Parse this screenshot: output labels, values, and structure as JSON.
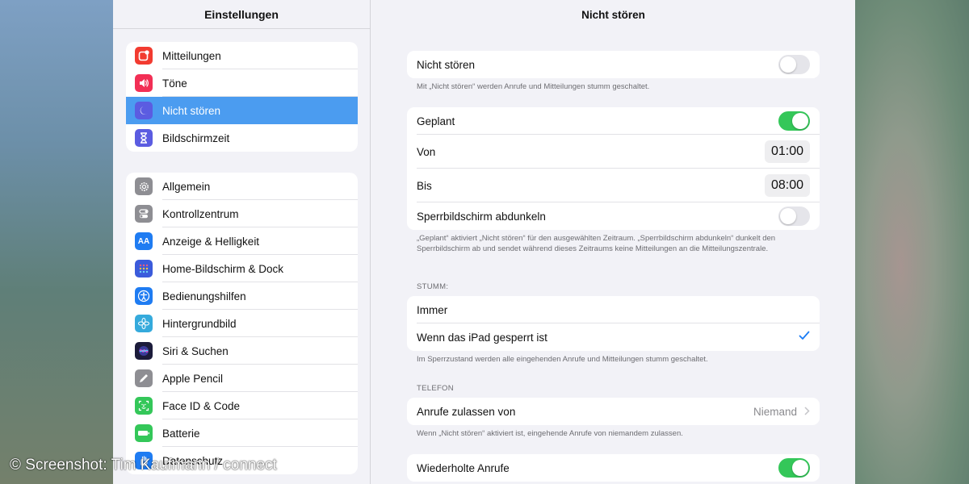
{
  "sidebar": {
    "title": "Einstellungen",
    "group1": [
      {
        "label": "Mitteilungen",
        "icon": "notifications-icon",
        "color": "#f23b30"
      },
      {
        "label": "Töne",
        "icon": "sound-icon",
        "color": "#f22f55"
      },
      {
        "label": "Nicht stören",
        "icon": "moon-icon",
        "color": "#5b5ce1",
        "selected": true
      },
      {
        "label": "Bildschirmzeit",
        "icon": "hourglass-icon",
        "color": "#5b5ce1"
      }
    ],
    "group2": [
      {
        "label": "Allgemein",
        "icon": "gear-icon",
        "color": "#8e8e93"
      },
      {
        "label": "Kontrollzentrum",
        "icon": "toggles-icon",
        "color": "#8e8e93"
      },
      {
        "label": "Anzeige & Helligkeit",
        "icon": "display-icon",
        "color": "#1f7cf2"
      },
      {
        "label": "Home-Bildschirm & Dock",
        "icon": "grid-icon",
        "color": "#3b5bdb"
      },
      {
        "label": "Bedienungshilfen",
        "icon": "accessibility-icon",
        "color": "#1f7cf2"
      },
      {
        "label": "Hintergrundbild",
        "icon": "flower-icon",
        "color": "#35aadc"
      },
      {
        "label": "Siri & Suchen",
        "icon": "siri-icon",
        "color": "#1b1b3a"
      },
      {
        "label": "Apple Pencil",
        "icon": "pencil-icon",
        "color": "#8e8e93"
      },
      {
        "label": "Face ID & Code",
        "icon": "faceid-icon",
        "color": "#34c759"
      },
      {
        "label": "Batterie",
        "icon": "battery-icon",
        "color": "#34c759"
      },
      {
        "label": "Datenschutz",
        "icon": "hand-icon",
        "color": "#1f7cf2"
      }
    ]
  },
  "detail": {
    "title": "Nicht stören",
    "dnd_label": "Nicht stören",
    "dnd_on": false,
    "dnd_footnote": "Mit „Nicht stören“ werden Anrufe und Mitteilungen stumm geschaltet.",
    "scheduled_label": "Geplant",
    "scheduled_on": true,
    "from_label": "Von",
    "from_value": "01:00",
    "to_label": "Bis",
    "to_value": "08:00",
    "dim_label": "Sperrbildschirm abdunkeln",
    "dim_on": false,
    "scheduled_footnote": "„Geplant“ aktiviert „Nicht stören“ für den ausgewählten Zeitraum. „Sperrbildschirm abdunkeln“ dunkelt den Sperrbildschirm ab und sendet während dieses Zeitraums keine Mitteilungen an die Mitteilungszentrale.",
    "silence_section": "STUMM:",
    "always_label": "Immer",
    "locked_label": "Wenn das iPad gesperrt ist",
    "locked_selected": true,
    "silence_footnote": "Im Sperrzustand werden alle eingehenden Anrufe und Mitteilungen stumm geschaltet.",
    "phone_section": "TELEFON",
    "allow_calls_label": "Anrufe zulassen von",
    "allow_calls_value": "Niemand",
    "allow_calls_footnote": "Wenn „Nicht stören“ aktiviert ist, eingehende Anrufe von niemandem zulassen.",
    "repeated_calls_label": "Wiederholte Anrufe",
    "repeated_calls_on": true
  },
  "watermark": "© Screenshot: Tim Kaufmann / connect",
  "colors": {
    "accent": "#4b9cf0",
    "toggle_on": "#34c759",
    "check": "#1a7cf5"
  }
}
